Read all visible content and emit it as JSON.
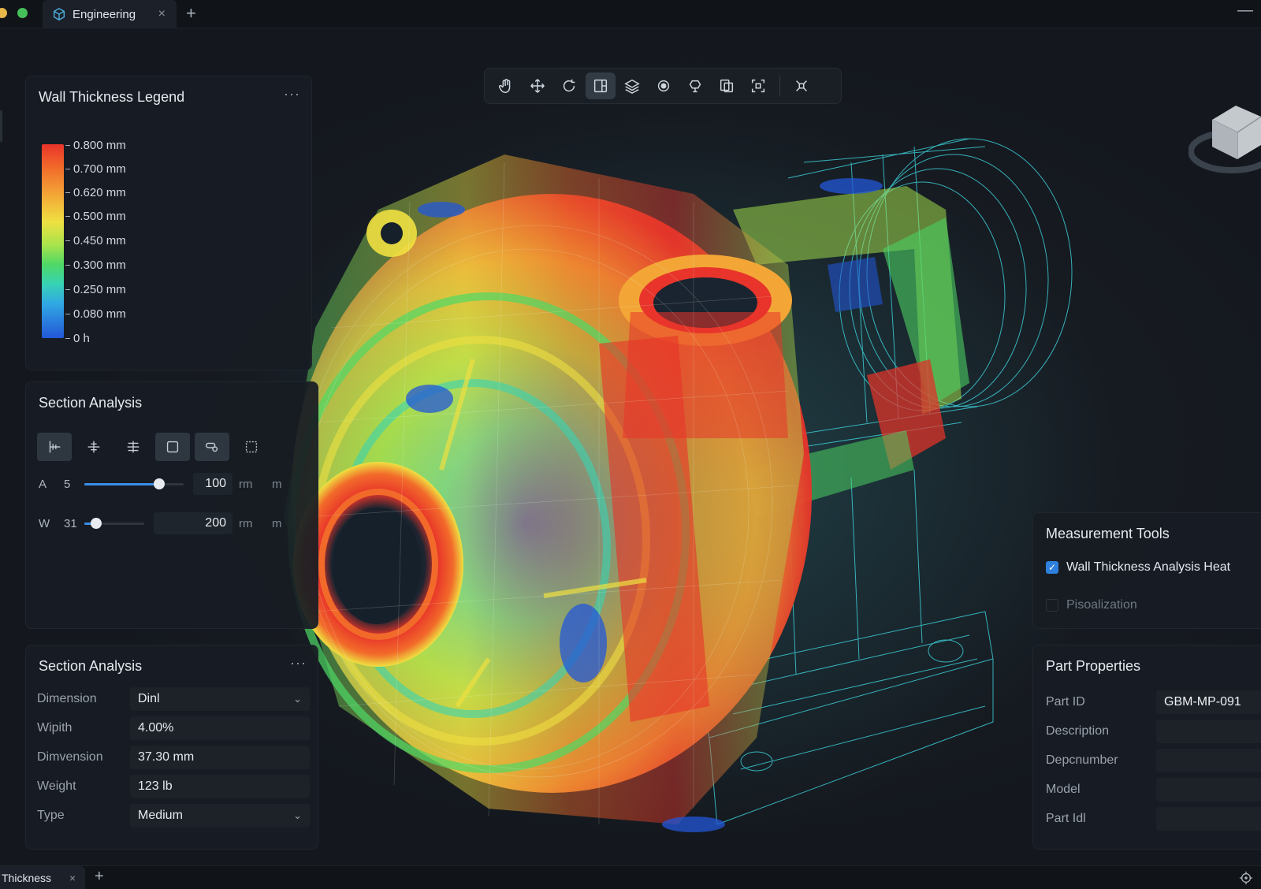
{
  "window": {
    "tab_title": "Engineering",
    "tab_close": "×",
    "new_tab": "+",
    "minimize": "—"
  },
  "toolbar": {
    "tools": [
      {
        "name": "pan-hand-icon",
        "active": false
      },
      {
        "name": "move-icon",
        "active": false
      },
      {
        "name": "rotate-icon",
        "active": false
      },
      {
        "name": "section-view-icon",
        "active": true
      },
      {
        "name": "layers-icon",
        "active": false
      },
      {
        "name": "zoom-icon",
        "active": false
      },
      {
        "name": "explode-icon",
        "active": false
      },
      {
        "name": "copy-view-icon",
        "active": false
      },
      {
        "name": "fit-view-icon",
        "active": false
      },
      {
        "name": "reset-view-icon",
        "active": false
      }
    ]
  },
  "legend": {
    "title": "Wall Thickness Legend",
    "more": "···",
    "ticks": [
      "0.800 mm",
      "0.700 mm",
      "0.620 mm",
      "0.500 mm",
      "0.450 mm",
      "0.300 mm",
      "0.250 mm",
      "0.080 mm",
      "0 h"
    ]
  },
  "section_analysis": {
    "title": "Section Analysis",
    "sliders": [
      {
        "axis": "A",
        "min": "5",
        "value": "100",
        "unit": "rm",
        "unit2": "m",
        "fill_fraction": 0.75
      },
      {
        "axis": "W",
        "min": "31",
        "value": "200",
        "unit": "rm",
        "unit2": "m",
        "fill_fraction": 0.18
      }
    ]
  },
  "section_properties": {
    "title": "Section Analysis",
    "more": "···",
    "rows": [
      {
        "label": "Dimension",
        "value": "Dinl",
        "dropdown": true
      },
      {
        "label": "Wipith",
        "value": "4.00%",
        "dropdown": false
      },
      {
        "label": "Dimvension",
        "value": "37.30 mm",
        "dropdown": false
      },
      {
        "label": "Weight",
        "value": "123 lb",
        "dropdown": false
      },
      {
        "label": "Type",
        "value": "Medium",
        "dropdown": true
      }
    ]
  },
  "measurement": {
    "title": "Measurement Tools",
    "checked_label": "Wall Thickness Analysis Heat",
    "sub_label": "Pisoalization",
    "check_glyph": "✓"
  },
  "part_properties": {
    "title": "Part Properties",
    "rows": [
      {
        "label": "Part ID",
        "value": "GBM-MP-091"
      },
      {
        "label": "Description",
        "value": ""
      },
      {
        "label": "Depcnumber",
        "value": ""
      },
      {
        "label": "Model",
        "value": ""
      },
      {
        "label": "Part Idl",
        "value": ""
      }
    ]
  },
  "bottom": {
    "tab_title": "Thickness",
    "tab_close": "×",
    "new_tab": "+"
  },
  "colors": {
    "heat_high": "#e8342a",
    "heat_mid": "#efe041",
    "heat_green": "#4fd865",
    "heat_low": "#2357d8",
    "wire": "#3fd6e0",
    "accent": "#2f7fdc"
  }
}
